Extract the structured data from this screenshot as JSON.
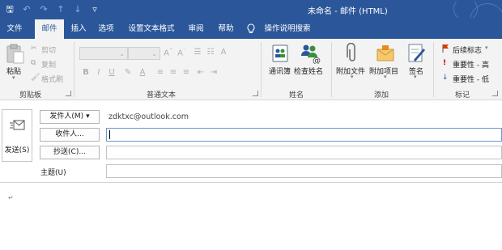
{
  "window": {
    "title": "未命名 - 邮件 (HTML)"
  },
  "qat": {
    "save": "🖫",
    "undo": "↶",
    "redo": "↷",
    "up": "↑",
    "down": "↓",
    "more": "▿"
  },
  "tabs": [
    {
      "label": "文件"
    },
    {
      "label": "邮件",
      "active": true
    },
    {
      "label": "插入"
    },
    {
      "label": "选项"
    },
    {
      "label": "设置文本格式"
    },
    {
      "label": "审阅"
    },
    {
      "label": "帮助"
    }
  ],
  "tell_me": "操作说明搜索",
  "ribbon": {
    "clipboard": {
      "label": "剪贴板",
      "paste": "粘贴",
      "cut": "剪切",
      "copy": "复制",
      "format_painter": "格式刷"
    },
    "basic_text": {
      "label": "普通文本"
    },
    "names": {
      "label": "姓名",
      "address_book": "通讯簿",
      "check_names": "检查姓名"
    },
    "include": {
      "label": "添加",
      "attach_file": "附加文件",
      "attach_item": "附加项目",
      "signature": "签名"
    },
    "tags": {
      "label": "标记",
      "follow_up": "后续标志",
      "high_importance": "重要性 - 高",
      "low_importance": "重要性 - 低"
    }
  },
  "compose": {
    "send": "发送(S)",
    "from_button": "发件人(M)",
    "from_value": "zdktxc@outlook.com",
    "to_button": "收件人...",
    "cc_button": "抄送(C)...",
    "subject_label": "主题(U)",
    "to_value": "",
    "cc_value": "",
    "subject_value": "",
    "paragraph_mark": "↵"
  },
  "colors": {
    "accent": "#2b579a",
    "ribbon_bg": "#f3f3f3",
    "flag": "#d83b01",
    "important": "#c00000",
    "low": "#2b579a"
  }
}
